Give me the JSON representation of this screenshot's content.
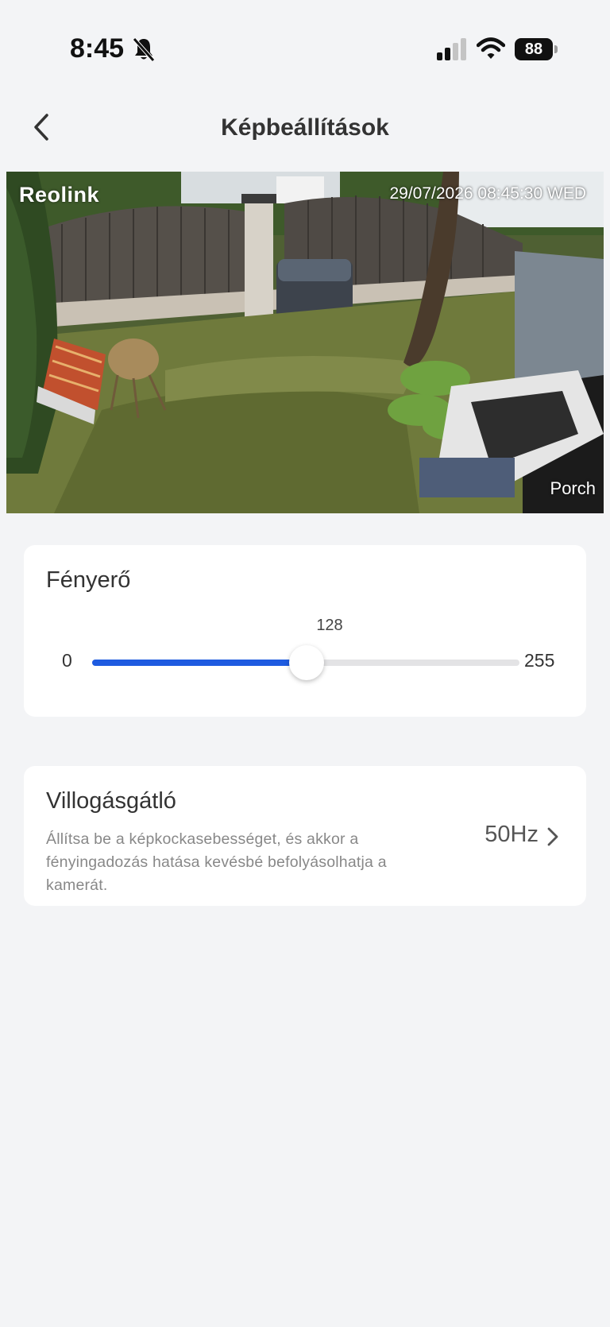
{
  "status_bar": {
    "time": "8:45",
    "battery": "88",
    "icons": [
      "bell-slash-icon",
      "signal-icon",
      "wifi-icon",
      "battery-icon"
    ]
  },
  "header": {
    "title": "Képbeállítások",
    "back_icon": "chevron-left-icon"
  },
  "camera": {
    "brand": "Reolink",
    "timestamp": "29/07/2026 08:45:30 WED",
    "name": "Porch"
  },
  "brightness": {
    "label": "Fényerő",
    "value": "128",
    "min": "0",
    "max": "255",
    "fill_fraction": 0.502,
    "accent_color": "#1e5be0"
  },
  "flicker": {
    "label": "Villogásgátló",
    "description": "Állítsa be a képkockasebességet, és akkor a fényingadozás hatása kevésbé befolyásolhatja a kamerát.",
    "value": "50Hz",
    "icon": "chevron-right-icon"
  }
}
